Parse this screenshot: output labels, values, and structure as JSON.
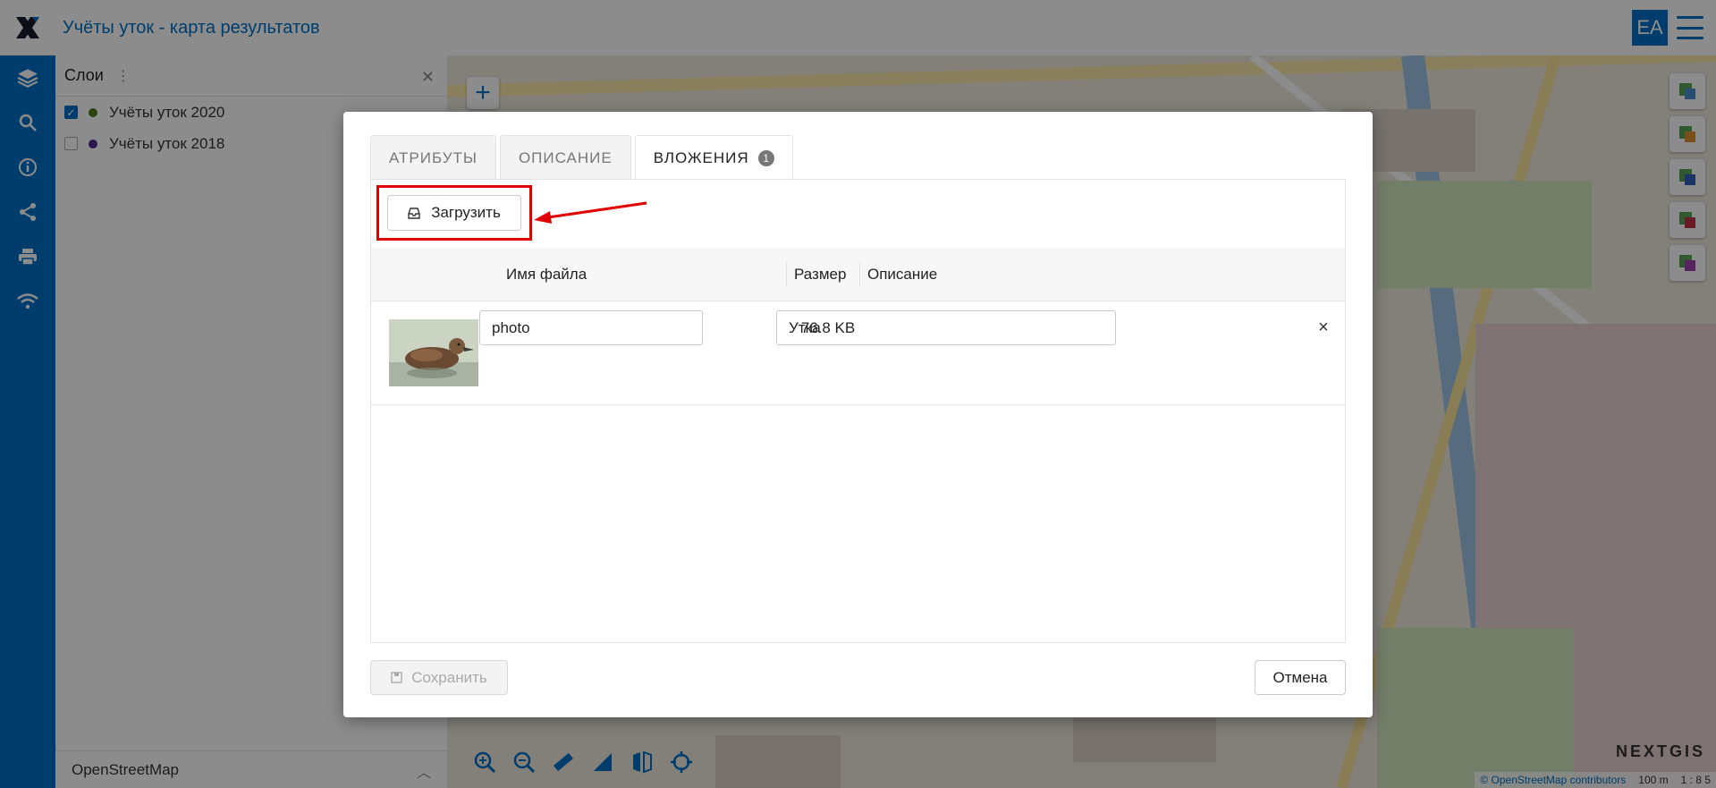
{
  "header": {
    "title": "Учёты уток - карта результатов",
    "avatar": "EA"
  },
  "sidebar": {
    "icons": [
      "layers-icon",
      "search-icon",
      "info-icon",
      "share-icon",
      "print-icon",
      "wifi-icon"
    ]
  },
  "layers_panel": {
    "title": "Слои",
    "layers": [
      {
        "label": "Учёты уток 2020",
        "checked": true,
        "color": "#4a7a1e"
      },
      {
        "label": "Учёты уток 2018",
        "checked": false,
        "color": "#4b2a8c"
      }
    ],
    "basemap": "OpenStreetMap"
  },
  "map": {
    "zoom_in_label": "+",
    "brand": "NEXTGIS",
    "attribution": "© OpenStreetMap contributors",
    "scale_distance": "100 m",
    "scale_ratio": "1 : 8 5"
  },
  "modal": {
    "tabs": [
      {
        "label": "АТРИБУТЫ",
        "active": false
      },
      {
        "label": "ОПИСАНИЕ",
        "active": false
      },
      {
        "label": "ВЛОЖЕНИЯ",
        "active": true,
        "badge": "1"
      }
    ],
    "upload_label": "Загрузить",
    "columns": {
      "name": "Имя файла",
      "size": "Размер",
      "description": "Описание"
    },
    "rows": [
      {
        "name": "photo",
        "size": "76.8 KB",
        "description": "Утка"
      }
    ],
    "delete_label": "×",
    "save_label": "Сохранить",
    "cancel_label": "Отмена"
  },
  "colors": {
    "brand_blue": "#0070c5",
    "highlight_red": "#e00000"
  }
}
